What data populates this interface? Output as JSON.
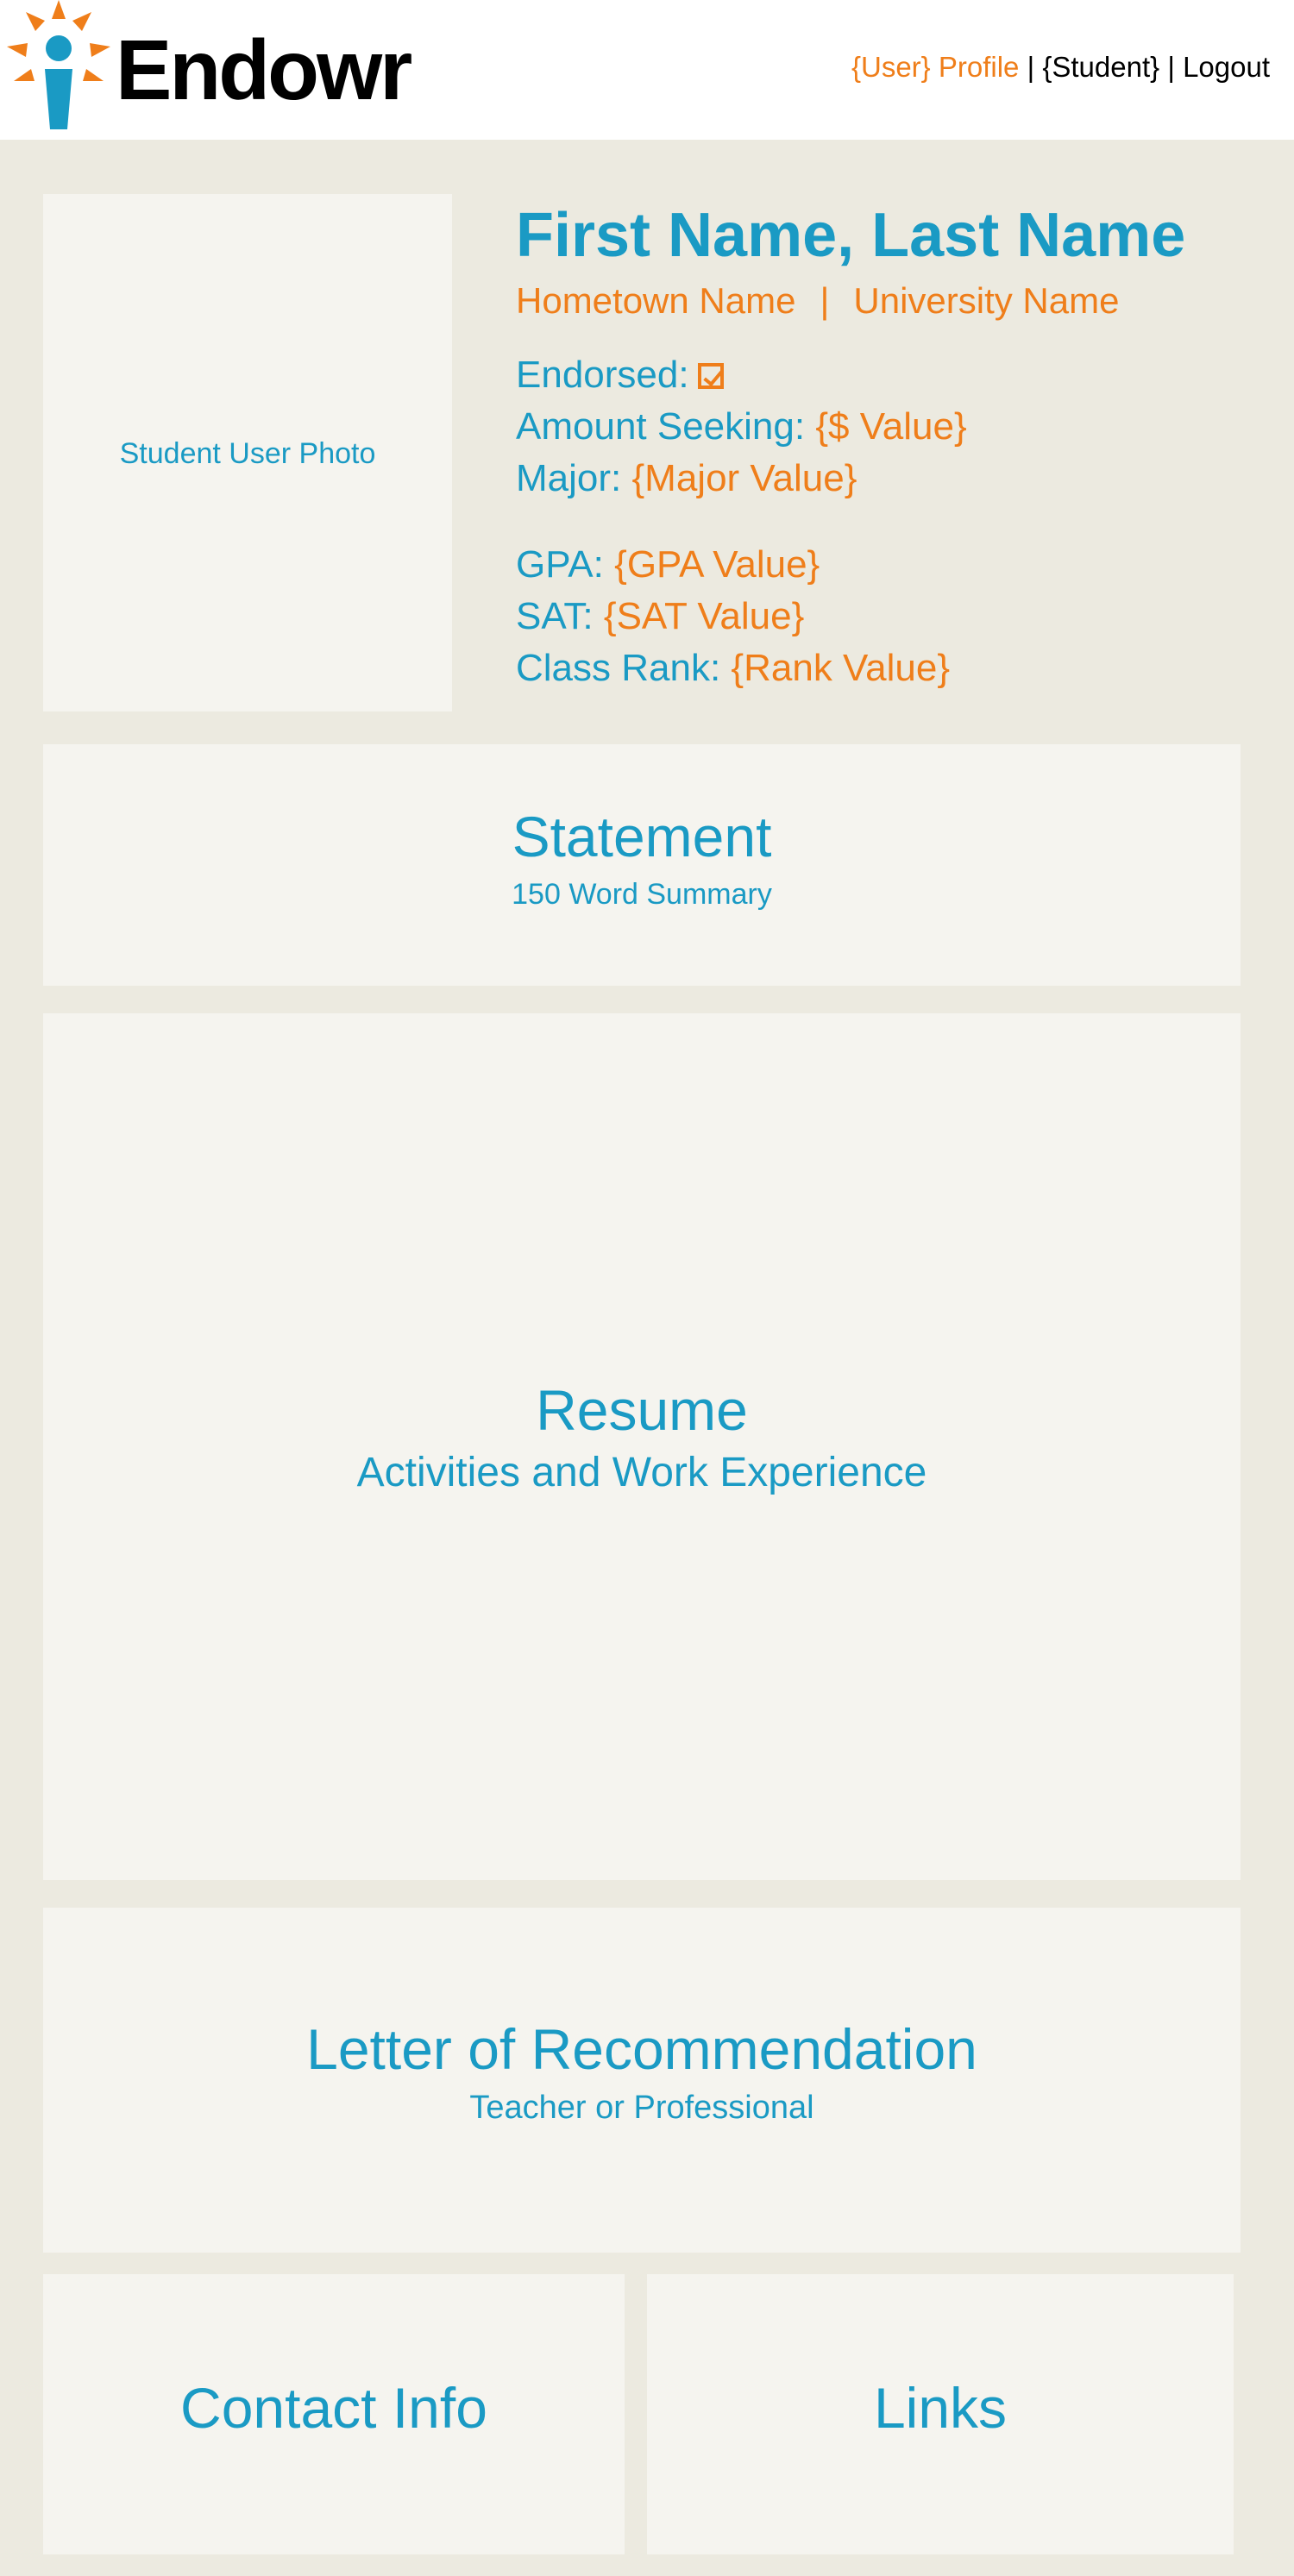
{
  "header": {
    "logo_text": "Endowr",
    "nav": {
      "user_profile": "{User} Profile",
      "separator": "|",
      "student": "{Student}",
      "logout": "Logout"
    }
  },
  "profile": {
    "photo_label": "Student User Photo",
    "name": "First Name, Last Name",
    "hometown": "Hometown Name",
    "divider": "|",
    "university": "University Name",
    "endorsed_label": "Endorsed:",
    "amount_label": "Amount Seeking:",
    "amount_value": "{$ Value}",
    "major_label": "Major:",
    "major_value": "{Major Value}",
    "gpa_label": "GPA:",
    "gpa_value": "{GPA Value}",
    "sat_label": "SAT:",
    "sat_value": "{SAT Value}",
    "rank_label": "Class Rank:",
    "rank_value": "{Rank Value}"
  },
  "sections": {
    "statement": {
      "title": "Statement",
      "subtitle": "150 Word Summary"
    },
    "resume": {
      "title": "Resume",
      "subtitle": "Activities and Work Experience"
    },
    "letter": {
      "title": "Letter of Recommendation",
      "subtitle": "Teacher or Professional"
    },
    "contact": {
      "title": "Contact Info"
    },
    "links": {
      "title": "Links"
    }
  },
  "colors": {
    "accent_blue": "#1a9ac4",
    "accent_orange": "#ef7e1a",
    "background": "#eceae0",
    "panel": "#f5f4ef"
  }
}
